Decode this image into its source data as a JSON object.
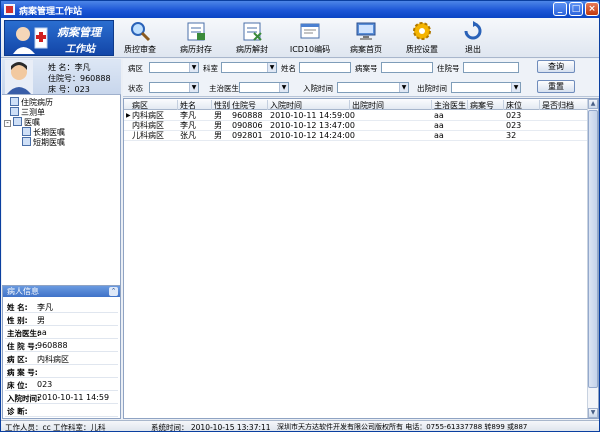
{
  "window": {
    "title": "病案管理工作站"
  },
  "logo": {
    "line1": "病案管理",
    "line2": "工作站"
  },
  "toolbar": {
    "buttons": [
      {
        "label": "质控审查",
        "icon": "search-icon"
      },
      {
        "label": "病历封存",
        "icon": "archive-icon"
      },
      {
        "label": "病历解封",
        "icon": "unlock-icon"
      },
      {
        "label": "ICD10编码",
        "icon": "code-icon"
      },
      {
        "label": "病案首页",
        "icon": "monitor-icon"
      },
      {
        "label": "质控设置",
        "icon": "gear-icon"
      },
      {
        "label": "退出",
        "icon": "exit-icon"
      }
    ]
  },
  "patient_card": {
    "name_label": "姓 名：李凡",
    "no_label": "住院号：960888",
    "bed_label": "床 号：023"
  },
  "tree": {
    "items": [
      {
        "label": "住院病历"
      },
      {
        "label": "三测单"
      },
      {
        "label": "医嘱"
      },
      {
        "label": "长期医嘱"
      },
      {
        "label": "短期医嘱"
      }
    ]
  },
  "info": {
    "title": "病人信息",
    "rows": [
      {
        "key": "姓 名:",
        "value": "李凡"
      },
      {
        "key": "性 别:",
        "value": "男"
      },
      {
        "key": "主治医生:",
        "value": "aa"
      },
      {
        "key": "住 院 号:",
        "value": "960888"
      },
      {
        "key": "病 区:",
        "value": "内科病区"
      },
      {
        "key": "病 案 号:",
        "value": ""
      },
      {
        "key": "床 位:",
        "value": "023"
      },
      {
        "key": "入院时间:",
        "value": "2010-10-11 14:59"
      },
      {
        "key": "诊 断:",
        "value": ""
      }
    ]
  },
  "filters": {
    "ward": "病区",
    "dept": "科室",
    "name": "姓名",
    "case_no": "病案号",
    "inpatient_no": "住院号",
    "status": "状态",
    "doctor": "主治医生",
    "admit_time": "入院时间",
    "discharge_time": "出院时间",
    "query_btn": "查询",
    "reset_btn": "重置"
  },
  "grid": {
    "headers": [
      "病区",
      "姓名",
      "性别",
      "住院号",
      "入院时间",
      "出院时间",
      "主治医生",
      "病案号",
      "床位",
      "是否归档"
    ],
    "rows": [
      [
        "内科病区",
        "李凡",
        "男",
        "960888",
        "2010-10-11 14:59:00",
        "",
        "aa",
        "",
        "023",
        ""
      ],
      [
        "内科病区",
        "李凡",
        "男",
        "090806",
        "2010-10-12 13:47:00",
        "",
        "aa",
        "",
        "023",
        ""
      ],
      [
        "儿科病区",
        "张凡",
        "男",
        "092801",
        "2010-10-12 14:24:00",
        "",
        "aa",
        "",
        "32",
        ""
      ]
    ]
  },
  "status": {
    "user": "工作人员：cc",
    "dept": "工作科室：儿科",
    "time": "系统时间： 2010-10-15 13:37:11",
    "company": "深圳市天方达软件开发有限公司版权所有 电话：0755-61337788 转899 或887"
  }
}
